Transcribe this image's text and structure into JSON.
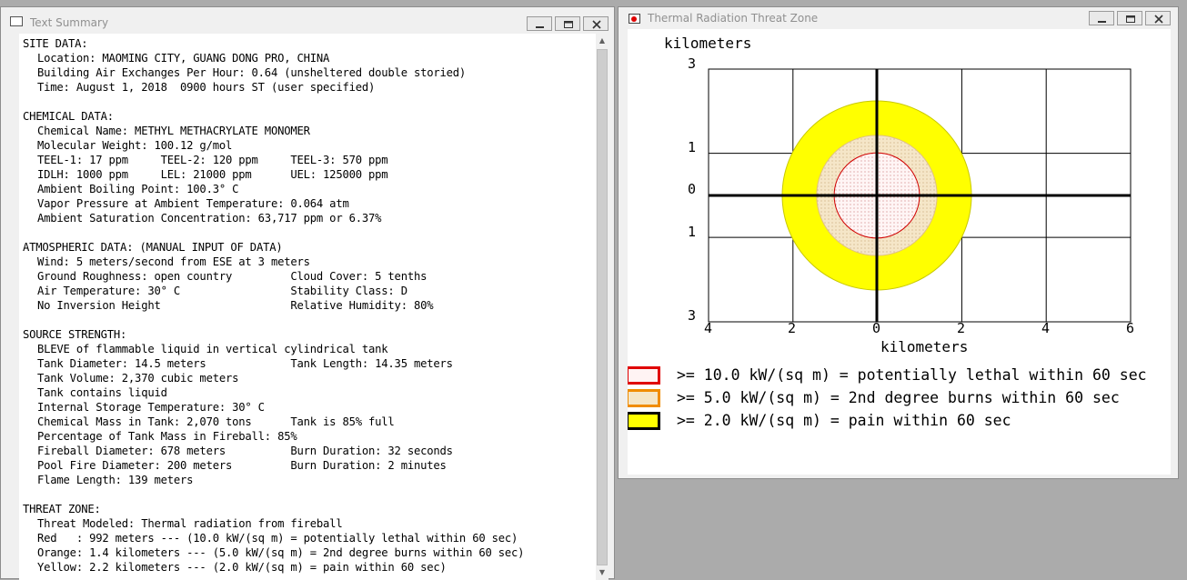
{
  "text_window": {
    "title": "Text Summary",
    "sections": [
      {
        "heading": "SITE DATA:",
        "lines": [
          "Location: MAOMING CITY, GUANG DONG PRO, CHINA",
          "Building Air Exchanges Per Hour: 0.64 (unsheltered double storied)",
          "Time: August 1, 2018  0900 hours ST (user specified)"
        ]
      },
      {
        "heading": "CHEMICAL DATA:",
        "lines": [
          "Chemical Name: METHYL METHACRYLATE MONOMER",
          "Molecular Weight: 100.12 g/mol",
          "TEEL-1: 17 ppm     TEEL-2: 120 ppm     TEEL-3: 570 ppm",
          "IDLH: 1000 ppm     LEL: 21000 ppm      UEL: 125000 ppm",
          "Ambient Boiling Point: 100.3° C",
          "Vapor Pressure at Ambient Temperature: 0.064 atm",
          "Ambient Saturation Concentration: 63,717 ppm or 6.37%"
        ]
      },
      {
        "heading": "ATMOSPHERIC DATA: (MANUAL INPUT OF DATA)",
        "lines": [
          "Wind: 5 meters/second from ESE at 3 meters",
          "Ground Roughness: open country         Cloud Cover: 5 tenths",
          "Air Temperature: 30° C                 Stability Class: D",
          "No Inversion Height                    Relative Humidity: 80%"
        ]
      },
      {
        "heading": "SOURCE STRENGTH:",
        "lines": [
          "BLEVE of flammable liquid in vertical cylindrical tank",
          "Tank Diameter: 14.5 meters             Tank Length: 14.35 meters",
          "Tank Volume: 2,370 cubic meters",
          "Tank contains liquid",
          "Internal Storage Temperature: 30° C",
          "Chemical Mass in Tank: 2,070 tons      Tank is 85% full",
          "Percentage of Tank Mass in Fireball: 85%",
          "Fireball Diameter: 678 meters          Burn Duration: 32 seconds",
          "Pool Fire Diameter: 200 meters         Burn Duration: 2 minutes",
          "Flame Length: 139 meters"
        ]
      },
      {
        "heading": "THREAT ZONE:",
        "lines": [
          "Threat Modeled: Thermal radiation from fireball",
          "Red   : 992 meters --- (10.0 kW/(sq m) = potentially lethal within 60 sec)",
          "Orange: 1.4 kilometers --- (5.0 kW/(sq m) = 2nd degree burns within 60 sec)",
          "Yellow: 2.2 kilometers --- (2.0 kW/(sq m) = pain within 60 sec)"
        ]
      }
    ]
  },
  "threat_window": {
    "title": "Thermal Radiation Threat Zone",
    "y_unit": "kilometers",
    "x_unit": "kilometers",
    "y_ticks": [
      "3",
      "1",
      "0",
      "1",
      "3"
    ],
    "x_ticks": [
      "4",
      "2",
      "0",
      "2",
      "4",
      "6"
    ],
    "legend": [
      {
        "label": ">= 10.0 kW/(sq m) = potentially lethal within 60 sec",
        "color": "#e00000"
      },
      {
        "label": ">= 5.0 kW/(sq m) = 2nd degree burns within 60 sec",
        "color": "#f08c00"
      },
      {
        "label": ">= 2.0 kW/(sq m) = pain within 60 sec",
        "color": "#000000"
      }
    ],
    "zones_km": {
      "red_radius": 0.992,
      "orange_radius": 1.4,
      "yellow_radius": 2.2
    }
  },
  "colors": {
    "yellow_zone": "#ffff00",
    "orange_zone": "#f5e6c8",
    "red_zone": "#fff5f5"
  },
  "window_buttons": [
    "minimize",
    "maximize",
    "close"
  ]
}
